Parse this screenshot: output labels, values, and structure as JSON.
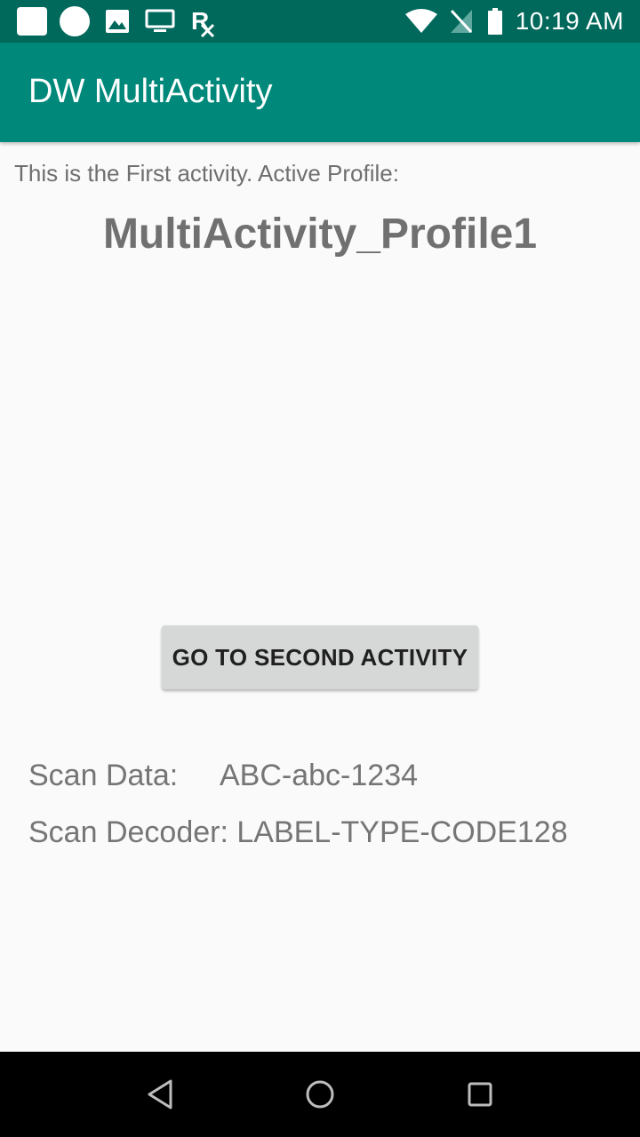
{
  "status_bar": {
    "time": "10:19 AM",
    "left_icons": [
      "square-notification-icon",
      "circle-notification-icon",
      "image-icon",
      "monitor-icon",
      "rx-icon"
    ],
    "right_icons": [
      "wifi-icon",
      "no-signal-icon",
      "battery-icon"
    ]
  },
  "app_bar": {
    "title": "DW MultiActivity"
  },
  "main": {
    "intro_text": "This is the First activity. Active Profile:",
    "profile_name": "MultiActivity_Profile1",
    "go_button_label": "GO TO SECOND ACTIVITY",
    "scan_data_label": "Scan Data:",
    "scan_data_value": "ABC-abc-1234",
    "scan_decoder_label": "Scan Decoder:",
    "scan_decoder_value": "LABEL-TYPE-CODE128"
  },
  "nav_bar": {
    "buttons": [
      "back-icon",
      "home-icon",
      "recents-icon"
    ]
  },
  "colors": {
    "status_bar": "#00695c",
    "app_bar": "#00897b",
    "background": "#fafafa",
    "button": "#d6d7d7"
  }
}
